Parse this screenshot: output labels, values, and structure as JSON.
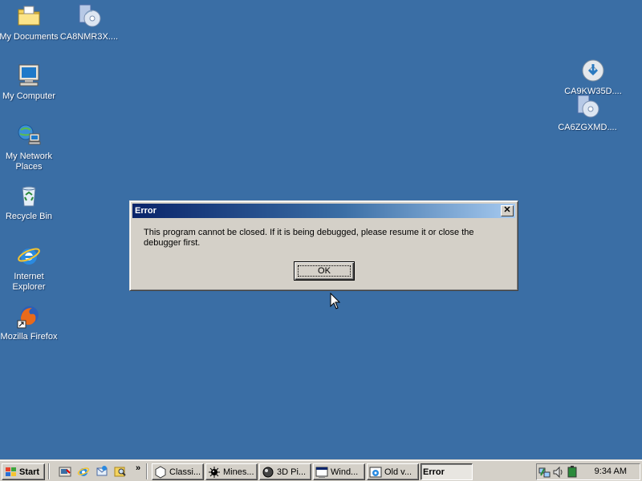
{
  "desktop": {
    "icons": [
      {
        "label": "My Documents"
      },
      {
        "label": "CA8NMR3X...."
      },
      {
        "label": "My Computer"
      },
      {
        "label": "My Network\nPlaces"
      },
      {
        "label": "Recycle Bin"
      },
      {
        "label": "Internet\nExplorer"
      },
      {
        "label": "Mozilla Firefox"
      },
      {
        "label": "CA9KW35D...."
      },
      {
        "label": "CA6ZGXMD...."
      }
    ]
  },
  "dialog": {
    "title": "Error",
    "close_label": "✕",
    "message": "This program cannot be closed. If it is being debugged, please resume it or close the debugger first.",
    "ok_label": "OK"
  },
  "taskbar": {
    "start_label": "Start",
    "more_label": "»",
    "buttons": [
      {
        "label": "Classi...",
        "icon": "hexagon-icon"
      },
      {
        "label": "Mines...",
        "icon": "mine-icon"
      },
      {
        "label": "3D Pi...",
        "icon": "pinball-icon"
      },
      {
        "label": "Wind...",
        "icon": "window-icon"
      },
      {
        "label": "Old v...",
        "icon": "ie-icon"
      },
      {
        "label": "Error",
        "icon": "",
        "active": true
      }
    ],
    "clock": "9:34 AM"
  },
  "colors": {
    "desktop": "#3a6ea5",
    "title_start": "#0a246a",
    "title_end": "#a6caf0",
    "face": "#d4d0c8"
  }
}
